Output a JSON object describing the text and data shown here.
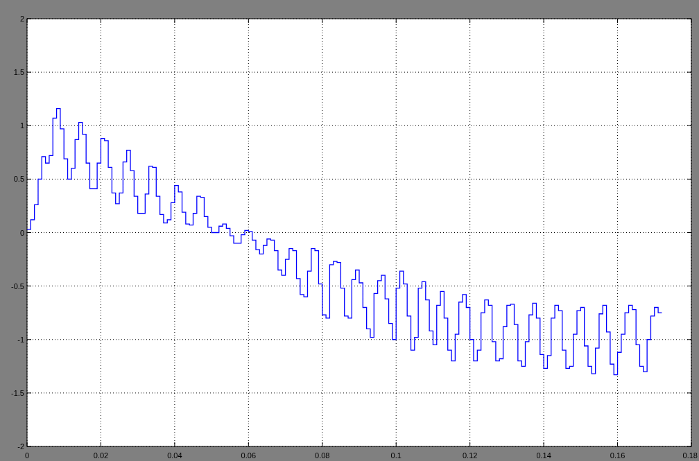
{
  "plot": {
    "chart_data": {
      "type": "line",
      "grid": true,
      "xlim": [
        0,
        0.18
      ],
      "ylim": [
        -2,
        2
      ],
      "xticks": [
        0,
        0.02,
        0.04,
        0.06,
        0.08,
        0.1,
        0.12,
        0.14,
        0.16,
        0.18
      ],
      "yticks": [
        -2,
        -1.5,
        -1,
        -0.5,
        0,
        0.5,
        1,
        1.5,
        2
      ],
      "x": [
        0,
        0.001,
        0.001,
        0.002,
        0.002,
        0.003,
        0.003,
        0.004,
        0.004,
        0.005,
        0.005,
        0.006,
        0.006,
        0.007,
        0.007,
        0.008,
        0.008,
        0.009,
        0.009,
        0.01,
        0.01,
        0.011,
        0.011,
        0.012,
        0.012,
        0.013,
        0.013,
        0.014,
        0.014,
        0.015,
        0.015,
        0.016,
        0.016,
        0.017,
        0.017,
        0.018,
        0.018,
        0.019,
        0.019,
        0.02,
        0.02,
        0.021,
        0.021,
        0.022,
        0.022,
        0.023,
        0.023,
        0.024,
        0.024,
        0.025,
        0.025,
        0.026,
        0.026,
        0.027,
        0.027,
        0.028,
        0.028,
        0.029,
        0.029,
        0.03,
        0.03,
        0.031,
        0.031,
        0.032,
        0.032,
        0.033,
        0.033,
        0.034,
        0.034,
        0.035,
        0.035,
        0.036,
        0.036,
        0.037,
        0.037,
        0.038,
        0.038,
        0.039,
        0.039,
        0.04,
        0.04,
        0.041,
        0.041,
        0.042,
        0.042,
        0.043,
        0.043,
        0.044,
        0.044,
        0.045,
        0.045,
        0.046,
        0.046,
        0.047,
        0.047,
        0.048,
        0.048,
        0.049,
        0.049,
        0.05,
        0.05,
        0.051,
        0.051,
        0.052,
        0.052,
        0.053,
        0.053,
        0.054,
        0.054,
        0.055,
        0.055,
        0.056,
        0.056,
        0.057,
        0.057,
        0.058,
        0.058,
        0.059,
        0.059,
        0.06,
        0.06,
        0.061,
        0.061,
        0.062,
        0.062,
        0.063,
        0.063,
        0.064,
        0.064,
        0.065,
        0.065,
        0.066,
        0.066,
        0.067,
        0.067,
        0.068,
        0.068,
        0.069,
        0.069,
        0.07,
        0.07,
        0.071,
        0.071,
        0.072,
        0.072,
        0.073,
        0.073,
        0.074,
        0.074,
        0.075,
        0.075,
        0.076,
        0.076,
        0.077,
        0.077,
        0.078,
        0.078,
        0.079,
        0.079,
        0.08,
        0.08,
        0.081,
        0.081,
        0.082,
        0.082,
        0.083,
        0.083,
        0.084,
        0.084,
        0.085,
        0.085,
        0.086,
        0.086,
        0.087,
        0.087,
        0.088,
        0.088,
        0.089,
        0.089,
        0.09,
        0.09,
        0.091,
        0.091,
        0.092,
        0.092,
        0.093,
        0.093,
        0.094,
        0.094,
        0.095,
        0.095,
        0.096,
        0.096,
        0.097,
        0.097,
        0.098,
        0.098,
        0.099,
        0.099,
        0.1,
        0.1,
        0.101,
        0.101,
        0.102,
        0.102,
        0.103,
        0.103,
        0.104,
        0.104,
        0.105,
        0.105,
        0.106,
        0.106,
        0.107,
        0.107,
        0.108,
        0.108,
        0.109,
        0.109,
        0.11,
        0.11,
        0.111,
        0.111,
        0.112,
        0.112,
        0.113,
        0.113,
        0.114,
        0.114,
        0.115,
        0.115,
        0.116,
        0.116,
        0.117,
        0.117,
        0.118,
        0.118,
        0.119,
        0.119,
        0.12,
        0.12,
        0.121,
        0.121,
        0.122,
        0.122,
        0.123,
        0.123,
        0.124,
        0.124,
        0.125,
        0.125,
        0.126,
        0.126,
        0.127,
        0.127,
        0.128,
        0.128,
        0.129,
        0.129,
        0.13,
        0.13,
        0.131,
        0.131,
        0.132,
        0.132,
        0.133,
        0.133,
        0.134,
        0.134,
        0.135,
        0.135,
        0.136,
        0.136,
        0.137,
        0.137,
        0.138,
        0.138,
        0.139,
        0.139,
        0.14,
        0.14,
        0.141,
        0.141,
        0.142,
        0.142,
        0.143,
        0.143,
        0.144,
        0.144,
        0.145,
        0.145,
        0.146,
        0.146,
        0.147,
        0.147,
        0.148,
        0.148,
        0.149,
        0.149,
        0.15,
        0.15,
        0.151,
        0.151,
        0.152,
        0.152,
        0.153,
        0.153,
        0.154,
        0.154,
        0.155,
        0.155,
        0.156,
        0.156,
        0.157,
        0.157,
        0.158,
        0.158,
        0.159,
        0.159,
        0.16,
        0.16,
        0.161,
        0.161,
        0.162,
        0.162,
        0.163,
        0.163,
        0.164,
        0.164,
        0.165,
        0.165,
        0.166,
        0.166,
        0.167,
        0.167,
        0.168,
        0.168,
        0.169,
        0.169,
        0.17,
        0.17,
        0.171,
        0.171,
        0.172,
        0.172
      ],
      "series": [
        {
          "color": "#0000ff",
          "values": [
            0.03,
            0.03,
            0.12,
            0.12,
            0.26,
            0.26,
            0.5,
            0.5,
            0.71,
            0.71,
            0.65,
            0.65,
            0.72,
            0.72,
            1.07,
            1.07,
            1.16,
            1.16,
            0.97,
            0.97,
            0.69,
            0.69,
            0.5,
            0.5,
            0.6,
            0.6,
            0.87,
            0.87,
            1.03,
            1.03,
            0.92,
            0.92,
            0.65,
            0.65,
            0.41,
            0.41,
            0.41,
            0.41,
            0.65,
            0.65,
            0.88,
            0.88,
            0.86,
            0.86,
            0.61,
            0.61,
            0.37,
            0.37,
            0.27,
            0.27,
            0.37,
            0.37,
            0.66,
            0.66,
            0.77,
            0.77,
            0.58,
            0.58,
            0.34,
            0.34,
            0.18,
            0.18,
            0.18,
            0.18,
            0.36,
            0.36,
            0.62,
            0.62,
            0.61,
            0.61,
            0.34,
            0.34,
            0.17,
            0.17,
            0.09,
            0.09,
            0.12,
            0.12,
            0.28,
            0.28,
            0.44,
            0.44,
            0.38,
            0.38,
            0.19,
            0.19,
            0.08,
            0.08,
            0.07,
            0.07,
            0.18,
            0.18,
            0.34,
            0.34,
            0.33,
            0.33,
            0.15,
            0.15,
            0.05,
            0.05,
            0,
            0,
            0,
            0,
            0.06,
            0.06,
            0.08,
            0.08,
            0.04,
            0.04,
            -0.03,
            -0.03,
            -0.1,
            -0.1,
            -0.1,
            -0.1,
            -0.02,
            -0.02,
            0.02,
            0.02,
            0.01,
            0.01,
            -0.07,
            -0.07,
            -0.16,
            -0.16,
            -0.2,
            -0.2,
            -0.12,
            -0.12,
            -0.06,
            -0.06,
            -0.07,
            -0.07,
            -0.17,
            -0.17,
            -0.35,
            -0.35,
            -0.4,
            -0.4,
            -0.25,
            -0.25,
            -0.15,
            -0.15,
            -0.17,
            -0.17,
            -0.43,
            -0.43,
            -0.58,
            -0.58,
            -0.6,
            -0.6,
            -0.36,
            -0.36,
            -0.15,
            -0.15,
            -0.17,
            -0.17,
            -0.48,
            -0.48,
            -0.77,
            -0.77,
            -0.8,
            -0.8,
            -0.3,
            -0.3,
            -0.27,
            -0.27,
            -0.28,
            -0.28,
            -0.52,
            -0.52,
            -0.78,
            -0.78,
            -0.8,
            -0.8,
            -0.44,
            -0.44,
            -0.35,
            -0.35,
            -0.47,
            -0.47,
            -0.7,
            -0.7,
            -0.9,
            -0.9,
            -0.98,
            -0.98,
            -0.57,
            -0.57,
            -0.45,
            -0.45,
            -0.4,
            -0.4,
            -0.62,
            -0.62,
            -0.85,
            -0.85,
            -1.0,
            -1.0,
            -0.52,
            -0.52,
            -0.36,
            -0.36,
            -0.48,
            -0.48,
            -0.78,
            -0.78,
            -1.1,
            -1.1,
            -0.98,
            -0.98,
            -0.52,
            -0.52,
            -0.46,
            -0.46,
            -0.63,
            -0.63,
            -0.92,
            -0.92,
            -1.05,
            -1.05,
            -0.68,
            -0.68,
            -0.55,
            -0.55,
            -0.8,
            -0.8,
            -1.1,
            -1.1,
            -1.2,
            -1.2,
            -0.95,
            -0.95,
            -0.65,
            -0.65,
            -0.58,
            -0.58,
            -0.7,
            -0.7,
            -1.0,
            -1.0,
            -1.2,
            -1.2,
            -1.1,
            -1.1,
            -0.75,
            -0.75,
            -0.63,
            -0.63,
            -0.68,
            -0.68,
            -1.02,
            -1.02,
            -1.2,
            -1.2,
            -1.18,
            -1.18,
            -0.88,
            -0.88,
            -0.68,
            -0.68,
            -0.67,
            -0.67,
            -0.86,
            -0.86,
            -1.2,
            -1.2,
            -1.25,
            -1.25,
            -1.02,
            -1.02,
            -0.77,
            -0.77,
            -0.66,
            -0.66,
            -0.8,
            -0.8,
            -1.14,
            -1.14,
            -1.27,
            -1.27,
            -1.15,
            -1.15,
            -0.8,
            -0.8,
            -0.68,
            -0.68,
            -0.73,
            -0.73,
            -1.1,
            -1.1,
            -1.27,
            -1.27,
            -1.25,
            -1.25,
            -0.95,
            -0.95,
            -0.73,
            -0.73,
            -0.7,
            -0.7,
            -1.06,
            -1.06,
            -1.25,
            -1.25,
            -1.32,
            -1.32,
            -1.08,
            -1.08,
            -0.76,
            -0.76,
            -0.68,
            -0.68,
            -0.93,
            -0.93,
            -1.23,
            -1.23,
            -1.33,
            -1.33,
            -1.12,
            -1.12,
            -0.95,
            -0.95,
            -0.75,
            -0.75,
            -0.68,
            -0.68,
            -0.72,
            -0.72,
            -1.05,
            -1.05,
            -1.25,
            -1.25,
            -1.3,
            -1.3,
            -1.0,
            -1.0,
            -0.78,
            -0.78,
            -0.7,
            -0.7,
            -0.75,
            -0.75,
            -0.75
          ]
        }
      ]
    }
  }
}
